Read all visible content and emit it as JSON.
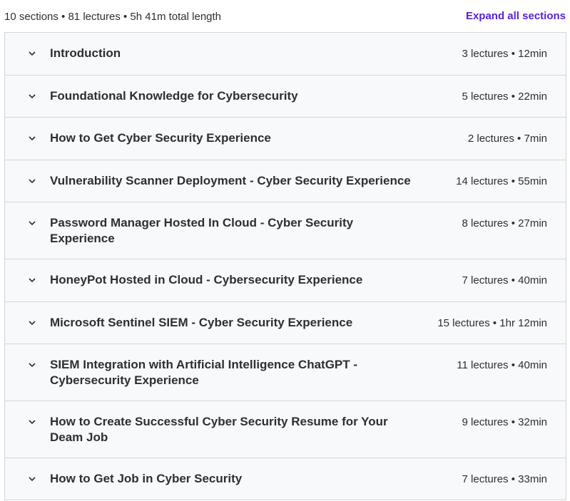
{
  "header": {
    "summary": "10 sections • 81 lectures • 5h 41m total length",
    "expand_label": "Expand all sections"
  },
  "sections": [
    {
      "title": "Introduction",
      "meta": "3 lectures • 12min"
    },
    {
      "title": "Foundational Knowledge for Cybersecurity",
      "meta": "5 lectures • 22min"
    },
    {
      "title": "How to Get Cyber Security Experience",
      "meta": "2 lectures • 7min"
    },
    {
      "title": "Vulnerability Scanner Deployment - Cyber Security Experience",
      "meta": "14 lectures • 55min"
    },
    {
      "title": "Password Manager Hosted In Cloud - Cyber Security",
      "title_line2": "Experience",
      "meta": "8 lectures • 27min"
    },
    {
      "title": "HoneyPot Hosted in Cloud - Cybersecurity Experience",
      "meta": "7 lectures • 40min"
    },
    {
      "title": "Microsoft Sentinel SIEM - Cyber Security Experience",
      "meta": "15 lectures • 1hr 12min"
    },
    {
      "title": "SIEM Integration with Artificial Intelligence ChatGPT -",
      "title_line2": "Cybersecurity Experience",
      "meta": "11 lectures • 40min"
    },
    {
      "title": "How to Create Successful Cyber Security Resume for Your",
      "title_line2": "Deam Job",
      "meta": "9 lectures • 32min"
    },
    {
      "title": "How to Get Job in Cyber Security",
      "meta": "7 lectures • 33min"
    }
  ]
}
